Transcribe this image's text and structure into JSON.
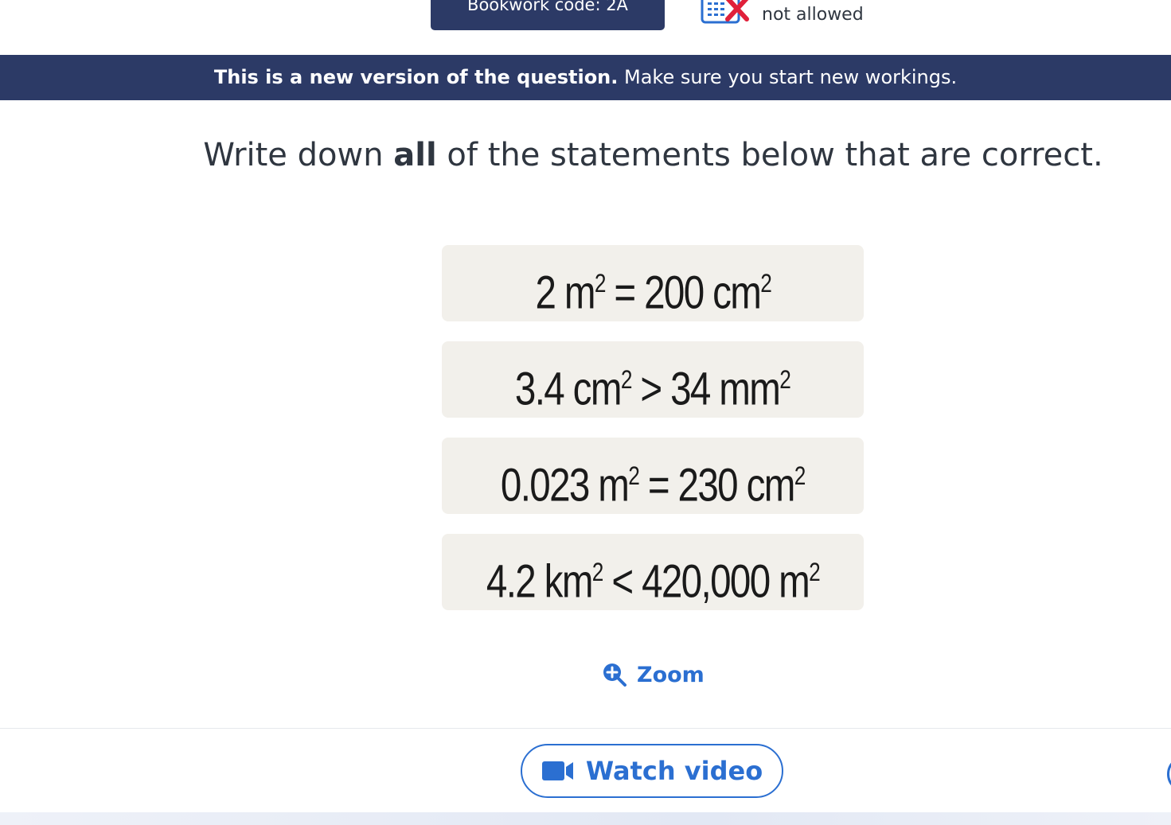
{
  "header": {
    "bookwork_code": "Bookwork code: 2A",
    "calculator_status": "not allowed"
  },
  "banner": {
    "bold_text": "This is a new version of the question.",
    "text": " Make sure you start new workings."
  },
  "question": {
    "prefix": "Write down ",
    "bold": "all",
    "suffix": " of the statements below that are correct."
  },
  "statements": [
    {
      "left_num": "2",
      "left_unit": "m",
      "op": "=",
      "right_num": "200",
      "right_unit": "cm",
      "exp": "2"
    },
    {
      "left_num": "3.4",
      "left_unit": "cm",
      "op": ">",
      "right_num": "34",
      "right_unit": "mm",
      "exp": "2"
    },
    {
      "left_num": "0.023",
      "left_unit": "m",
      "op": "=",
      "right_num": "230",
      "right_unit": "cm",
      "exp": "2"
    },
    {
      "left_num": "4.2",
      "left_unit": "km",
      "op": "<",
      "right_num": "420,000",
      "right_unit": "m",
      "exp": "2"
    }
  ],
  "zoom_label": "Zoom",
  "watch_video_label": "Watch video",
  "colors": {
    "navy": "#2c3a66",
    "accent_blue": "#2b6fd1",
    "card_bg": "#f2f0eb",
    "cross_red": "#e0203a"
  },
  "icons": {
    "calculator": "calculator-crossed-icon",
    "zoom": "zoom-in-icon",
    "video": "video-camera-icon"
  }
}
